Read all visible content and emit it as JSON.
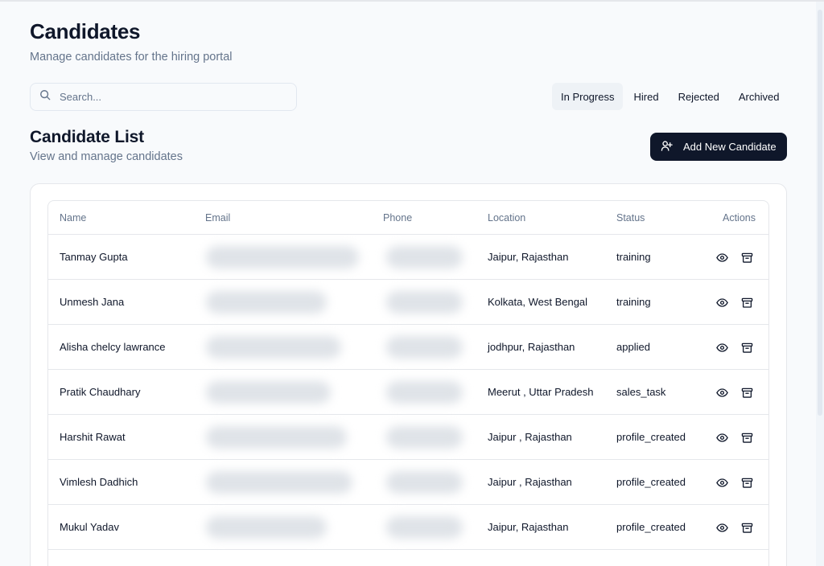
{
  "header": {
    "title": "Candidates",
    "subtitle": "Manage candidates for the hiring portal"
  },
  "search": {
    "placeholder": "Search...",
    "value": "",
    "icon": "search-icon"
  },
  "tabs": [
    {
      "label": "In Progress",
      "active": true
    },
    {
      "label": "Hired",
      "active": false
    },
    {
      "label": "Rejected",
      "active": false
    },
    {
      "label": "Archived",
      "active": false
    }
  ],
  "list": {
    "title": "Candidate List",
    "subtitle": "View and manage candidates",
    "add_button": {
      "label": "Add New Candidate",
      "icon": "user-plus-icon"
    }
  },
  "table": {
    "columns": [
      "Name",
      "Email",
      "Phone",
      "Location",
      "Status",
      "Actions"
    ],
    "rows": [
      {
        "name": "Tanmay Gupta",
        "location": "Jaipur, Rajasthan",
        "status": "training"
      },
      {
        "name": "Unmesh Jana",
        "location": "Kolkata, West Bengal",
        "status": "training"
      },
      {
        "name": "Alisha chelcy lawrance",
        "location": "jodhpur, Rajasthan",
        "status": "applied"
      },
      {
        "name": "Pratik Chaudhary",
        "location": "Meerut , Uttar Pradesh",
        "status": "sales_task"
      },
      {
        "name": "Harshit Rawat",
        "location": "Jaipur , Rajasthan",
        "status": "profile_created"
      },
      {
        "name": "Vimlesh Dadhich",
        "location": "Jaipur , Rajasthan",
        "status": "profile_created"
      },
      {
        "name": "Mukul Yadav",
        "location": "Jaipur, Rajasthan",
        "status": "profile_created"
      }
    ],
    "row_actions": [
      "eye-icon",
      "archive-icon"
    ]
  },
  "colors": {
    "background": "#f8fafc",
    "primary_button": "#0f172a",
    "muted_text": "#64748b",
    "border": "#e5e7eb",
    "active_tab": "#eef2f6"
  }
}
